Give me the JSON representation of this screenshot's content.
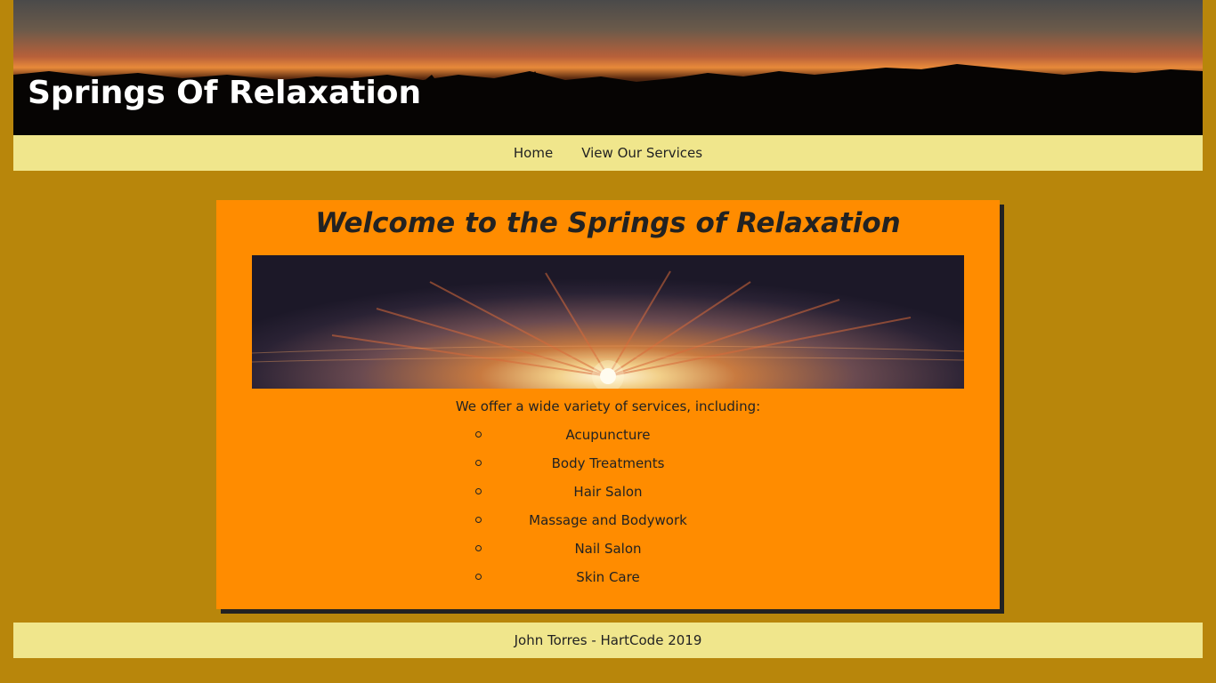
{
  "header": {
    "title": "Springs Of Relaxation"
  },
  "nav": {
    "items": [
      {
        "label": "Home"
      },
      {
        "label": "View Our Services"
      }
    ]
  },
  "main": {
    "heading": "Welcome to the Springs of Relaxation",
    "intro": "We offer a wide variety of services, including:",
    "services": [
      "Acupuncture",
      "Body Treatments",
      "Hair Salon",
      "Massage and Bodywork",
      "Nail Salon",
      "Skin Care"
    ]
  },
  "footer": {
    "text": "John Torres - HartCode 2019"
  },
  "colors": {
    "page_background": "#b8860b",
    "bar_background": "#f0e68c",
    "card_background": "#ff8c00",
    "card_shadow": "#222222",
    "title_text": "#ffffff"
  }
}
